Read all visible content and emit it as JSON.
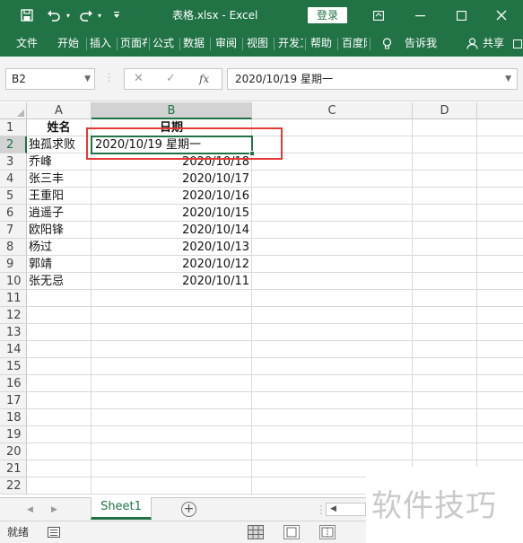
{
  "titlebar": {
    "save_icon": "save-icon",
    "undo_icon": "undo-icon",
    "redo_icon": "redo-icon",
    "customize_icon": "customize-qat-icon",
    "title": "表格.xlsx  -  Excel",
    "login_label": "登录",
    "ribbon_display_icon": "ribbon-display-icon",
    "minimize_icon": "minimize-icon",
    "maximize_icon": "maximize-icon",
    "close_icon": "close-icon",
    "background_color": "#217346"
  },
  "ribbon": {
    "tabs": [
      {
        "label": "文件"
      },
      {
        "label": "开始"
      },
      {
        "label": "插入"
      },
      {
        "label": "页面布局"
      },
      {
        "label": "公式"
      },
      {
        "label": "数据"
      },
      {
        "label": "审阅"
      },
      {
        "label": "视图"
      },
      {
        "label": "开发工具"
      },
      {
        "label": "帮助"
      },
      {
        "label": "百度网盘"
      }
    ],
    "tell_me_icon": "lightbulb-icon",
    "tell_me_label": "告诉我",
    "share_icon": "person-icon",
    "share_label": "共享"
  },
  "formula_bar": {
    "name_box_value": "B2",
    "cancel_icon": "cancel-x-icon",
    "confirm_icon": "checkmark-icon",
    "fx_label": "fx",
    "formula_value": "2020/10/19 星期一"
  },
  "grid": {
    "columns": [
      "A",
      "B",
      "C",
      "D"
    ],
    "active_column": "B",
    "active_row": "2",
    "rows": [
      {
        "num": "1",
        "a": "姓名",
        "b": "日期"
      },
      {
        "num": "2",
        "a": "独孤求败",
        "b": "2020/10/19 星期一"
      },
      {
        "num": "3",
        "a": "乔峰",
        "b": "2020/10/18"
      },
      {
        "num": "4",
        "a": "张三丰",
        "b": "2020/10/17"
      },
      {
        "num": "5",
        "a": "王重阳",
        "b": "2020/10/16"
      },
      {
        "num": "6",
        "a": "逍遥子",
        "b": "2020/10/15"
      },
      {
        "num": "7",
        "a": "欧阳锋",
        "b": "2020/10/14"
      },
      {
        "num": "8",
        "a": "杨过",
        "b": "2020/10/13"
      },
      {
        "num": "9",
        "a": "郭靖",
        "b": "2020/10/12"
      },
      {
        "num": "10",
        "a": "张无忌",
        "b": "2020/10/11"
      },
      {
        "num": "11",
        "a": "",
        "b": ""
      },
      {
        "num": "12",
        "a": "",
        "b": ""
      },
      {
        "num": "13",
        "a": "",
        "b": ""
      },
      {
        "num": "14",
        "a": "",
        "b": ""
      },
      {
        "num": "15",
        "a": "",
        "b": ""
      },
      {
        "num": "16",
        "a": "",
        "b": ""
      },
      {
        "num": "17",
        "a": "",
        "b": ""
      },
      {
        "num": "18",
        "a": "",
        "b": ""
      },
      {
        "num": "19",
        "a": "",
        "b": ""
      },
      {
        "num": "20",
        "a": "",
        "b": ""
      },
      {
        "num": "21",
        "a": "",
        "b": ""
      },
      {
        "num": "22",
        "a": "",
        "b": ""
      }
    ],
    "highlight_color": "#e53935",
    "selection_color": "#217346"
  },
  "sheets": {
    "tabs": [
      {
        "label": "Sheet1"
      }
    ],
    "add_label": "+",
    "prev_icon": "triangle-left-icon",
    "next_icon": "triangle-right-icon"
  },
  "status": {
    "ready_label": "就绪",
    "macro_icon": "macro-record-icon",
    "views": [
      "normal-view-icon",
      "page-layout-view-icon",
      "page-break-view-icon"
    ]
  },
  "watermark": {
    "text": "软件技巧"
  }
}
